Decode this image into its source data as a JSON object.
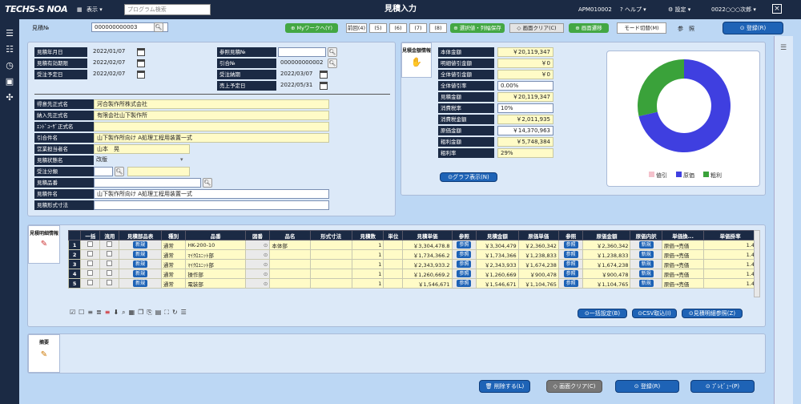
{
  "header": {
    "logo": "TECHS-S NOA",
    "view_menu": "表示",
    "search_placeholder": "プログラム検索",
    "title": "見積入力",
    "program_id": "APM010002",
    "help": "ヘルプ",
    "settings": "設定",
    "user": "0022○○○次郎"
  },
  "toolbar": {
    "label": "見積№",
    "value": "000000000003",
    "my_work": "Myワークへ(Y)",
    "prev": "前回(4)",
    "nav_buttons": [
      "(5)",
      "(6)",
      "(7)",
      "(8)"
    ],
    "save_cols": "選択値・列幅保存",
    "clear": "画面クリア(C)",
    "transition": "画面遷移",
    "mode_switch": "モード切替(M)",
    "ref": "参　照",
    "register": "登録(R)"
  },
  "dates": [
    {
      "label": "見積年月日",
      "value": "2022/01/07"
    },
    {
      "label": "見積有効期限",
      "value": "2022/02/07"
    },
    {
      "label": "受注予定日",
      "value": "2022/02/07"
    }
  ],
  "refs": [
    {
      "label": "参照見積№",
      "value": ""
    },
    {
      "label": "引合№",
      "value": "000000000002"
    },
    {
      "label": "受注納期",
      "value": "2022/03/07"
    },
    {
      "label": "売上予定日",
      "value": "2022/05/31"
    }
  ],
  "customer": [
    {
      "label": "得意先正式名",
      "value": "河合製作所株式会社"
    },
    {
      "label": "納入先正式名",
      "value": "有限会社山下製作所"
    },
    {
      "label": "ｴﾝﾄﾞﾕｰｻﾞ正式名",
      "value": ""
    },
    {
      "label": "引合件名",
      "value": "山下製作所向け A処理工程用装置一式"
    },
    {
      "label": "営業担当者名",
      "value": "山本　晃"
    },
    {
      "label": "見積状態名",
      "value": "改版"
    },
    {
      "label": "受注分類",
      "value": ""
    },
    {
      "label": "見積品番",
      "value": ""
    },
    {
      "label": "見積件名",
      "value": "山下製作所向け A処理工程用装置一式"
    },
    {
      "label": "見積形式寸法",
      "value": ""
    }
  ],
  "summary": {
    "tab_label": "見積金額情報",
    "rows": [
      {
        "label": "本体金額",
        "value": "￥20,119,347"
      },
      {
        "label": "明細値引金額",
        "value": "￥0"
      },
      {
        "label": "全体値引金額",
        "value": "￥0"
      },
      {
        "label": "全体値引率",
        "value": "0.00%"
      },
      {
        "label": "見積金額",
        "value": "￥20,119,347"
      },
      {
        "label": "消費税率",
        "value": "10%"
      },
      {
        "label": "消費税金額",
        "value": "￥2,011,935"
      },
      {
        "label": "原価金額",
        "value": "￥14,370,963"
      },
      {
        "label": "粗利金額",
        "value": "￥5,748,384"
      },
      {
        "label": "粗利率",
        "value": "29%"
      }
    ],
    "graph_button": "グラフ表示(N)"
  },
  "chart_data": {
    "type": "pie",
    "title": "",
    "categories": [
      "値引",
      "原価",
      "粗利"
    ],
    "values": [
      0,
      71.4,
      28.6
    ],
    "colors": [
      "#f4c2cc",
      "#3f3fe0",
      "#3aa23a"
    ],
    "legend_position": "bottom"
  },
  "details": {
    "tab_label": "見積明細情報",
    "columns": [
      "一括",
      "流用",
      "見積部品表",
      "種別",
      "品番",
      "図番",
      "品名",
      "形式寸法",
      "見積数",
      "単位",
      "見積単価",
      "参照",
      "見積金額",
      "原価単価",
      "参照",
      "原価金額",
      "原価内訳",
      "単価換...",
      "単価掛率"
    ],
    "new_label": "新規",
    "ref_label": "参照",
    "rows": [
      {
        "no": "1",
        "kind": "通常",
        "part": "HK-200-10",
        "name": "本体部",
        "qty": "1",
        "price": "￥3,304,478.8",
        "amount": "￥3,304,479",
        "cost_unit": "￥2,360,342",
        "cost": "￥2,360,342",
        "conv": "原価→売価",
        "rate": "1.4"
      },
      {
        "no": "2",
        "kind": "通常",
        "part": "ﾏｲｸﾛﾕﾆｯﾄ部",
        "name": "",
        "qty": "1",
        "price": "￥1,734,366.2",
        "amount": "￥1,734,366",
        "cost_unit": "￥1,238,833",
        "cost": "￥1,238,833",
        "conv": "原価→売価",
        "rate": "1.4"
      },
      {
        "no": "3",
        "kind": "通常",
        "part": "ﾏｲｸﾛﾕﾆｯﾄ部",
        "name": "",
        "qty": "1",
        "price": "￥2,343,933.2",
        "amount": "￥2,343,933",
        "cost_unit": "￥1,674,238",
        "cost": "￥1,674,238",
        "conv": "原価→売価",
        "rate": "1.4"
      },
      {
        "no": "4",
        "kind": "通常",
        "part": "操作部",
        "name": "",
        "qty": "1",
        "price": "￥1,260,669.2",
        "amount": "￥1,260,669",
        "cost_unit": "￥900,478",
        "cost": "￥900,478",
        "conv": "原価→売価",
        "rate": "1.4"
      },
      {
        "no": "5",
        "kind": "通常",
        "part": "電装部",
        "name": "",
        "qty": "1",
        "price": "￥1,546,671",
        "amount": "￥1,546,671",
        "cost_unit": "￥1,104,765",
        "cost": "￥1,104,765",
        "conv": "原価→売価",
        "rate": "1.4"
      }
    ],
    "bulk_setting": "一括設定(B)",
    "csv_import": "CSV取込(I)",
    "detail_ref": "見積明細参照(Z)"
  },
  "notes": {
    "tab_label": "摘要"
  },
  "footer": {
    "delete": "削除する(L)",
    "clear": "画面クリア(C)",
    "register": "登録(R)",
    "preview": "ﾌﾟﾚﾋﾞｭｰ(P)"
  }
}
